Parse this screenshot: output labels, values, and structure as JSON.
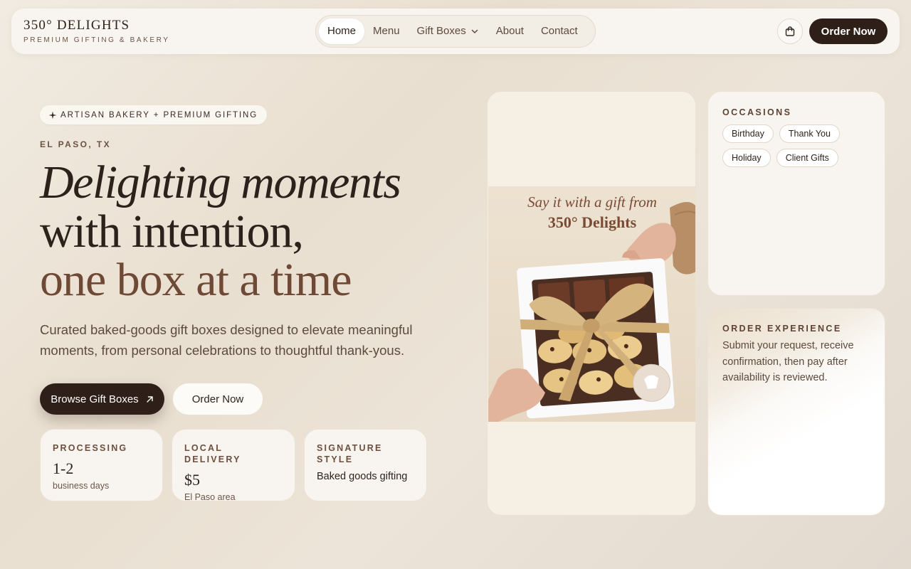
{
  "brand": {
    "name": "350° DELIGHTS",
    "tagline": "PREMIUM GIFTING & BAKERY"
  },
  "nav": {
    "items": [
      {
        "label": "Home",
        "active": true
      },
      {
        "label": "Menu"
      },
      {
        "label": "Gift Boxes",
        "dropdown": true
      },
      {
        "label": "About"
      },
      {
        "label": "Contact"
      }
    ],
    "cart_icon": "shopping-bag-icon",
    "order_label": "Order Now"
  },
  "hero": {
    "badge": "ARTISAN BAKERY + PREMIUM GIFTING",
    "location": "EL PASO, TX",
    "headline_line1": "Delighting moments",
    "headline_line2": "with intention,",
    "headline_line3": "one box at a time",
    "subcopy": "Curated baked-goods gift boxes designed to elevate meaningful moments, from personal celebrations to thoughtful thank-yous.",
    "primary_cta": "Browse Gift Boxes",
    "secondary_cta": "Order Now"
  },
  "stats": [
    {
      "label": "PROCESSING",
      "value": "1-2",
      "note": "business days"
    },
    {
      "label": "LOCAL DELIVERY",
      "value": "$5",
      "note": "El Paso area"
    },
    {
      "label": "SIGNATURE STYLE",
      "body": "Baked goods gifting"
    }
  ],
  "photo": {
    "caption_line1": "Say it with a gift from",
    "caption_line2": "350° Delights"
  },
  "occasions": {
    "title": "OCCASIONS",
    "chips": [
      "Birthday",
      "Thank You",
      "Holiday",
      "Client Gifts"
    ]
  },
  "order_experience": {
    "title": "ORDER EXPERIENCE",
    "body": "Submit your request, receive confirmation, then pay after availability is reviewed."
  },
  "colors": {
    "accent_dark": "#2e1f18",
    "accent_brown": "#6e4a36",
    "background": "#ece4d8"
  }
}
